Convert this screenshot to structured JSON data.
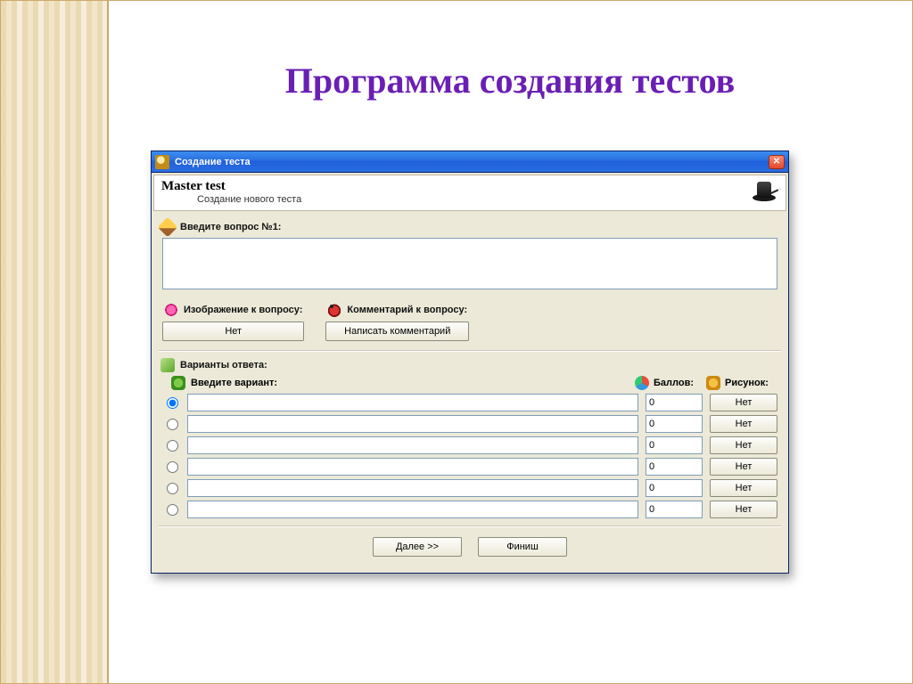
{
  "slide": {
    "title": "Программа создания тестов"
  },
  "window": {
    "title": "Создание теста",
    "header": {
      "title": "Master test",
      "subtitle": "Создание нового теста"
    },
    "question": {
      "label": "Введите вопрос №1:",
      "value": ""
    },
    "image_section": {
      "label": "Изображение к вопросу:",
      "button": "Нет"
    },
    "comment_section": {
      "label": "Комментарий к вопросу:",
      "button": "Написать комментарий"
    },
    "answers": {
      "title": "Варианты ответа:",
      "col_variant": "Введите вариант:",
      "col_score": "Баллов:",
      "col_picture": "Рисунок:",
      "rows": [
        {
          "selected": true,
          "text": "",
          "score": "0",
          "pic_button": "Нет"
        },
        {
          "selected": false,
          "text": "",
          "score": "0",
          "pic_button": "Нет"
        },
        {
          "selected": false,
          "text": "",
          "score": "0",
          "pic_button": "Нет"
        },
        {
          "selected": false,
          "text": "",
          "score": "0",
          "pic_button": "Нет"
        },
        {
          "selected": false,
          "text": "",
          "score": "0",
          "pic_button": "Нет"
        },
        {
          "selected": false,
          "text": "",
          "score": "0",
          "pic_button": "Нет"
        }
      ]
    },
    "footer": {
      "next": "Далее >>",
      "finish": "Финиш"
    }
  }
}
